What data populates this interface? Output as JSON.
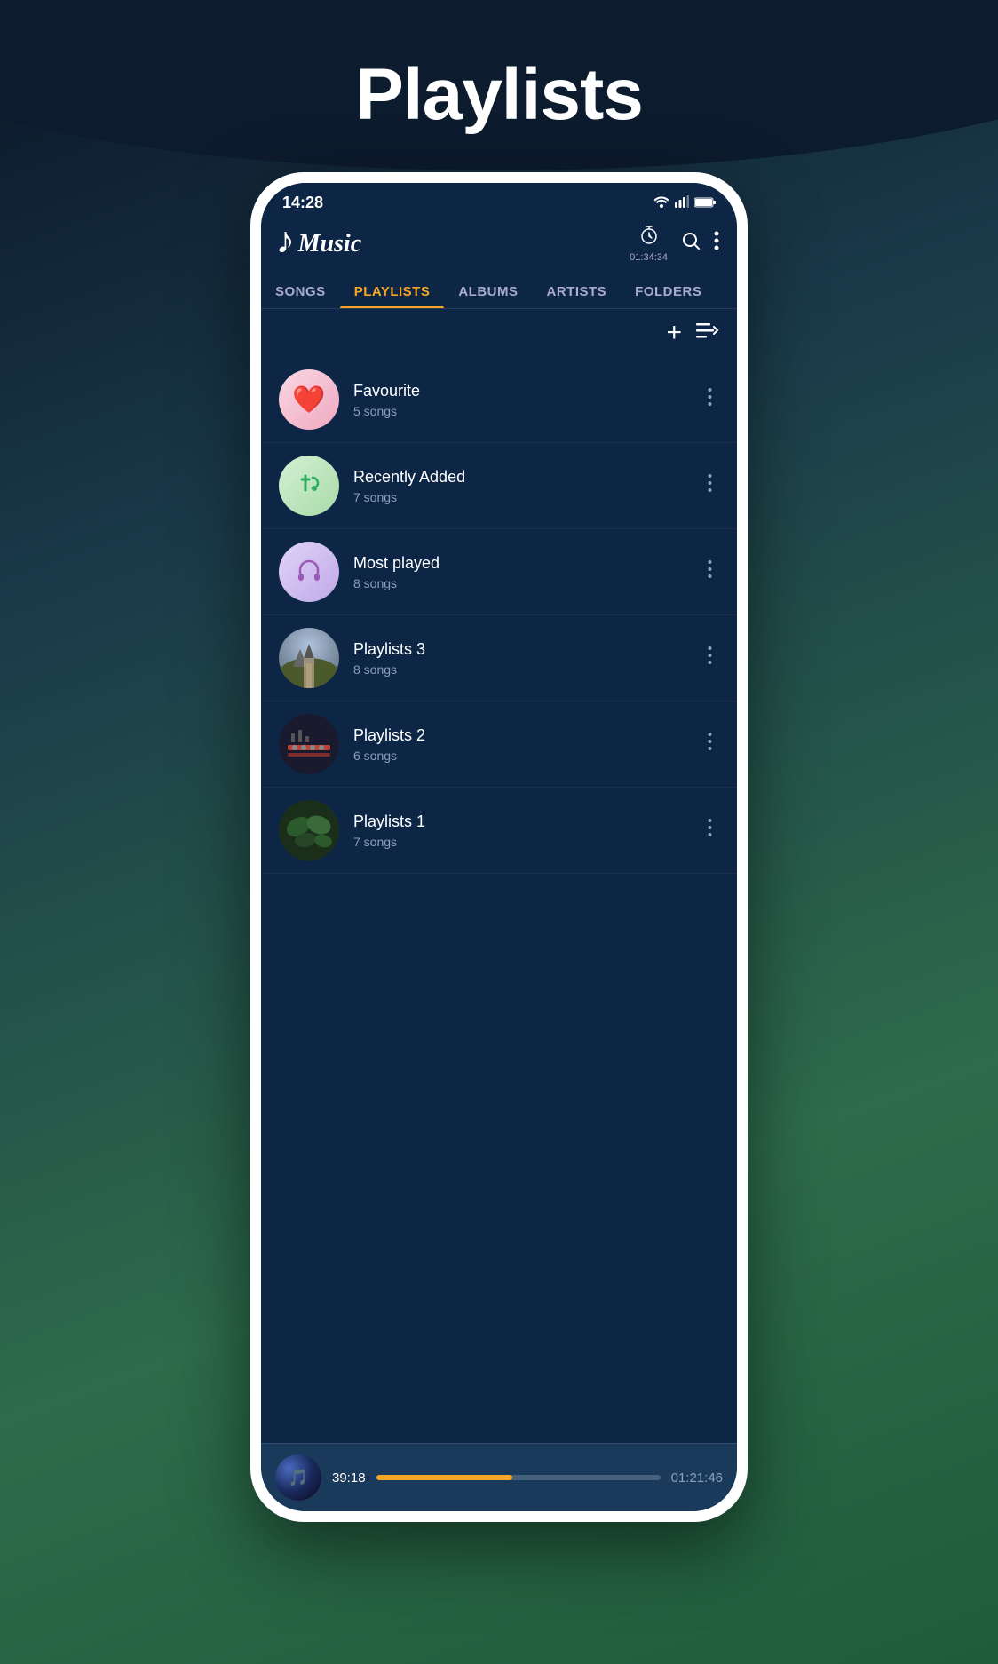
{
  "page": {
    "title": "Playlists",
    "background_colors": [
      "#0d1b2e",
      "#1a3a4a",
      "#2d6b4a",
      "#1e5c3a"
    ]
  },
  "status_bar": {
    "time": "14:28",
    "battery": "100%",
    "signal_icons": "📶"
  },
  "header": {
    "logo": "Music",
    "timer_value": "01:34:34",
    "timer_label": "01:34:34"
  },
  "nav_tabs": {
    "items": [
      {
        "label": "SONGS",
        "active": false
      },
      {
        "label": "PLAYLISTS",
        "active": true
      },
      {
        "label": "ALBUMS",
        "active": false
      },
      {
        "label": "ARTISTS",
        "active": false
      },
      {
        "label": "FOLDERS",
        "active": false
      }
    ]
  },
  "action_bar": {
    "add_label": "+",
    "sort_label": "⊟"
  },
  "playlists": [
    {
      "name": "Favourite",
      "count": "5 songs",
      "thumb_type": "favourite",
      "icon": "❤️"
    },
    {
      "name": "Recently Added",
      "count": "7 songs",
      "thumb_type": "recently",
      "icon": "🎵"
    },
    {
      "name": "Most played",
      "count": "8 songs",
      "thumb_type": "most",
      "icon": "🎧"
    },
    {
      "name": "Playlists 3",
      "count": "8 songs",
      "thumb_type": "landscape",
      "icon": ""
    },
    {
      "name": "Playlists 2",
      "count": "6 songs",
      "thumb_type": "synth",
      "icon": ""
    },
    {
      "name": "Playlists 1",
      "count": "7 songs",
      "thumb_type": "leaves",
      "icon": ""
    }
  ],
  "now_playing": {
    "time_current": "39:18",
    "time_total": "01:21:46",
    "progress_percent": 48
  }
}
